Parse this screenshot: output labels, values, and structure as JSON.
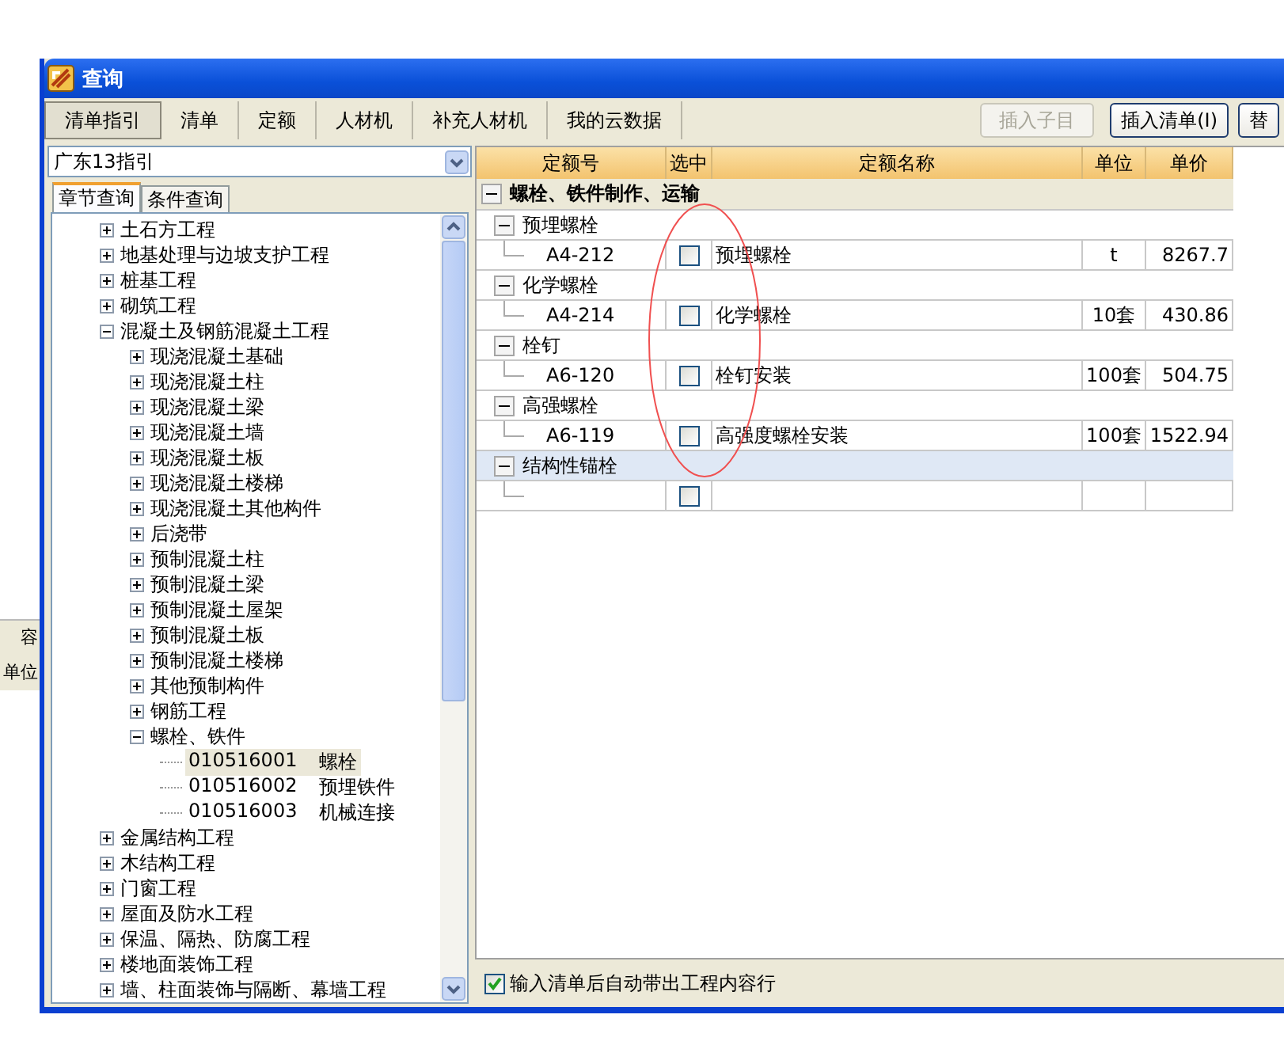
{
  "background_window": {
    "labels": [
      "容",
      "单位"
    ]
  },
  "window": {
    "title": "查询"
  },
  "tabs": [
    {
      "label": "清单指引",
      "selected": true
    },
    {
      "label": "清单",
      "selected": false
    },
    {
      "label": "定额",
      "selected": false
    },
    {
      "label": "人材机",
      "selected": false
    },
    {
      "label": "补充人材机",
      "selected": false
    },
    {
      "label": "我的云数据",
      "selected": false
    }
  ],
  "toolbar_buttons": [
    {
      "label": "插入子目",
      "disabled": true
    },
    {
      "label": "插入清单(I)",
      "disabled": false
    },
    {
      "label": "替",
      "disabled": false
    }
  ],
  "library_select": {
    "value": "广东13指引"
  },
  "sub_tabs": [
    {
      "label": "章节查询",
      "selected": true
    },
    {
      "label": "条件查询",
      "selected": false
    }
  ],
  "tree": [
    {
      "label": "土石方工程",
      "expanded": false
    },
    {
      "label": "地基处理与边坡支护工程",
      "expanded": false
    },
    {
      "label": "桩基工程",
      "expanded": false
    },
    {
      "label": "砌筑工程",
      "expanded": false
    },
    {
      "label": "混凝土及钢筋混凝土工程",
      "expanded": true,
      "children": [
        {
          "label": "现浇混凝土基础",
          "expanded": false
        },
        {
          "label": "现浇混凝土柱",
          "expanded": false
        },
        {
          "label": "现浇混凝土梁",
          "expanded": false
        },
        {
          "label": "现浇混凝土墙",
          "expanded": false
        },
        {
          "label": "现浇混凝土板",
          "expanded": false
        },
        {
          "label": "现浇混凝土楼梯",
          "expanded": false
        },
        {
          "label": "现浇混凝土其他构件",
          "expanded": false
        },
        {
          "label": "后浇带",
          "expanded": false
        },
        {
          "label": "预制混凝土柱",
          "expanded": false
        },
        {
          "label": "预制混凝土梁",
          "expanded": false
        },
        {
          "label": "预制混凝土屋架",
          "expanded": false
        },
        {
          "label": "预制混凝土板",
          "expanded": false
        },
        {
          "label": "预制混凝土楼梯",
          "expanded": false
        },
        {
          "label": "其他预制构件",
          "expanded": false
        },
        {
          "label": "钢筋工程",
          "expanded": false
        },
        {
          "label": "螺栓、铁件",
          "expanded": true,
          "children": [
            {
              "code": "010516001",
              "label": "螺栓",
              "selected": true
            },
            {
              "code": "010516002",
              "label": "预埋铁件",
              "selected": false
            },
            {
              "code": "010516003",
              "label": "机械连接",
              "selected": false
            }
          ]
        }
      ]
    },
    {
      "label": "金属结构工程",
      "expanded": false
    },
    {
      "label": "木结构工程",
      "expanded": false
    },
    {
      "label": "门窗工程",
      "expanded": false
    },
    {
      "label": "屋面及防水工程",
      "expanded": false
    },
    {
      "label": "保温、隔热、防腐工程",
      "expanded": false
    },
    {
      "label": "楼地面装饰工程",
      "expanded": false
    },
    {
      "label": "墙、柱面装饰与隔断、幕墙工程",
      "expanded": false
    }
  ],
  "table": {
    "columns": [
      "定额号",
      "选中",
      "定额名称",
      "单位",
      "单价"
    ],
    "group": {
      "title": "螺栓、铁件制作、运输",
      "expanded": true,
      "subgroups": [
        {
          "title": "预埋螺栓",
          "expanded": true,
          "selected": false,
          "rows": [
            {
              "code": "A4-212",
              "checked": false,
              "name": "预埋螺栓",
              "unit": "t",
              "price": "8267.7"
            }
          ]
        },
        {
          "title": "化学螺栓",
          "expanded": true,
          "selected": false,
          "rows": [
            {
              "code": "A4-214",
              "checked": false,
              "name": "化学螺栓",
              "unit": "10套",
              "price": "430.86"
            }
          ]
        },
        {
          "title": "栓钉",
          "expanded": true,
          "selected": false,
          "rows": [
            {
              "code": "A6-120",
              "checked": false,
              "name": "栓钉安装",
              "unit": "100套",
              "price": "504.75"
            }
          ]
        },
        {
          "title": "高强螺栓",
          "expanded": true,
          "selected": false,
          "rows": [
            {
              "code": "A6-119",
              "checked": false,
              "name": "高强度螺栓安装",
              "unit": "100套",
              "price": "1522.94"
            }
          ]
        },
        {
          "title": "结构性锚栓",
          "expanded": true,
          "selected": true,
          "rows": [
            {
              "checked": false
            }
          ]
        }
      ]
    }
  },
  "auto_fill_option": {
    "label": "输入清单后自动带出工程内容行",
    "checked": true
  }
}
